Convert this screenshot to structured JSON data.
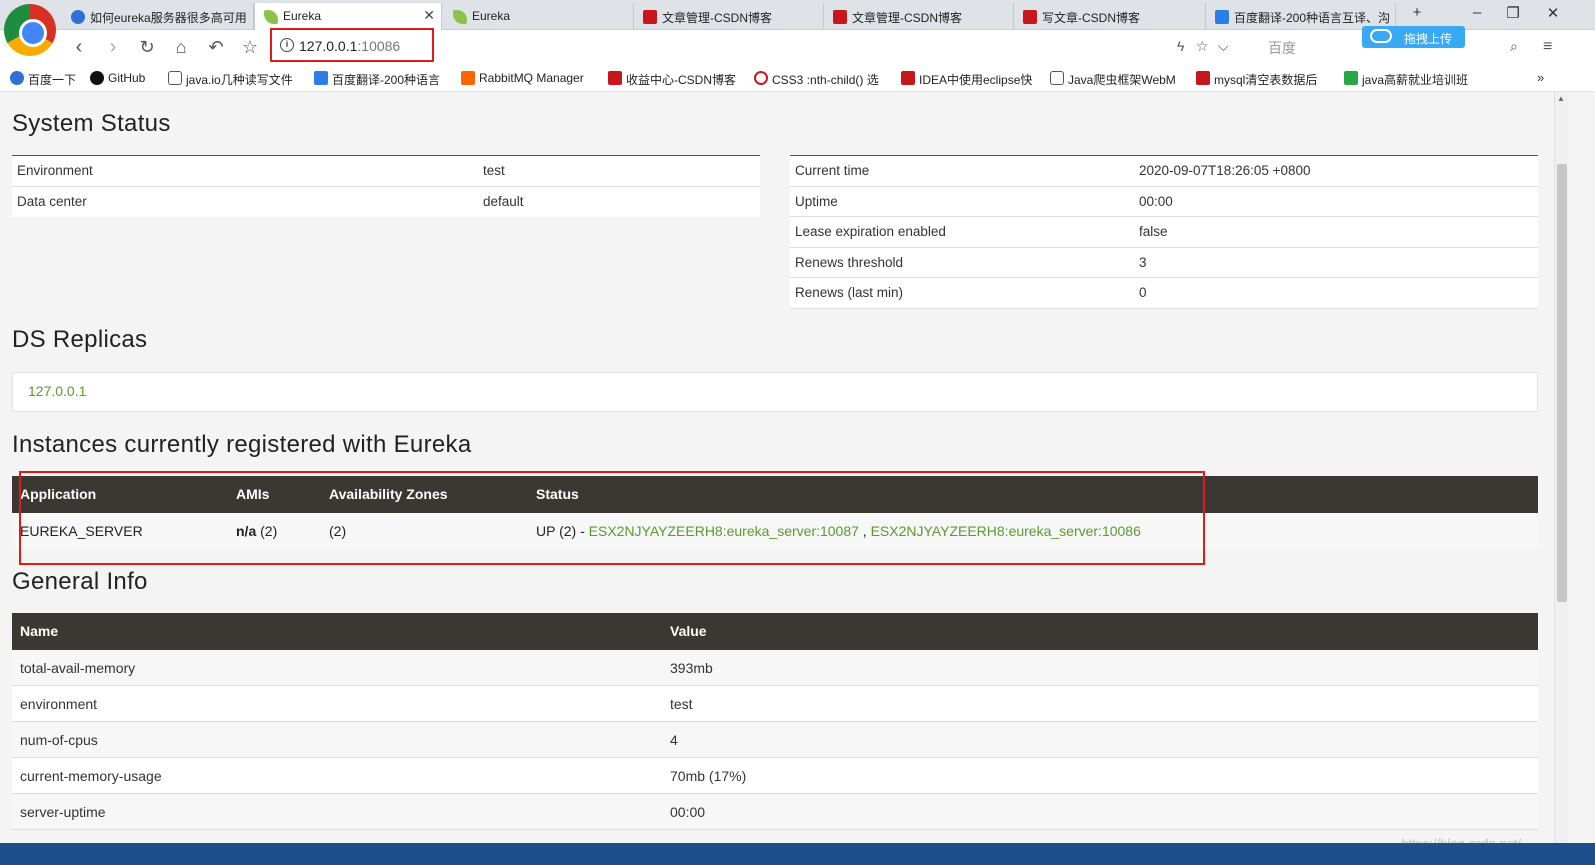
{
  "browser": {
    "tabs": [
      {
        "label": "如何eureka服务器很多高可用",
        "icon": "paw-icon"
      },
      {
        "label": "Eureka",
        "icon": "leaf-icon",
        "active": true
      },
      {
        "label": "Eureka",
        "icon": "leaf-icon"
      },
      {
        "label": "文章管理-CSDN博客",
        "icon": "csdn-icon"
      },
      {
        "label": "文章管理-CSDN博客",
        "icon": "csdn-icon"
      },
      {
        "label": "写文章-CSDN博客",
        "icon": "csdn-icon"
      },
      {
        "label": "百度翻译-200种语言互译、沟",
        "icon": "translate-icon"
      }
    ],
    "url_host": "127.0.0.1",
    "url_port": ":10086",
    "search_placeholder": "百度",
    "upload_label": "拖拽上传",
    "bookmarks": [
      "百度一下",
      "GitHub",
      "java.io几种读写文件",
      "百度翻译-200种语言",
      "RabbitMQ Manager",
      "收益中心-CSDN博客",
      "CSS3 :nth-child() 选",
      "IDEA中使用eclipse快",
      "Java爬虫框架WebM",
      "mysql清空表数据后",
      "java高薪就业培训班"
    ]
  },
  "system_status": {
    "title": "System Status",
    "left": [
      {
        "key": "Environment",
        "value": "test"
      },
      {
        "key": "Data center",
        "value": "default"
      }
    ],
    "right": [
      {
        "key": "Current time",
        "value": "2020-09-07T18:26:05 +0800"
      },
      {
        "key": "Uptime",
        "value": "00:00"
      },
      {
        "key": "Lease expiration enabled",
        "value": "false"
      },
      {
        "key": "Renews threshold",
        "value": "3"
      },
      {
        "key": "Renews (last min)",
        "value": "0"
      }
    ]
  },
  "replicas": {
    "title": "DS Replicas",
    "items": [
      "127.0.0.1"
    ]
  },
  "instances": {
    "title": "Instances currently registered with Eureka",
    "headers": [
      "Application",
      "AMIs",
      "Availability Zones",
      "Status"
    ],
    "rows": [
      {
        "application": "EUREKA_SERVER",
        "amis_bold": "n/a",
        "amis_count": " (2)",
        "zones": "(2)",
        "status_prefix": "UP (2) - ",
        "link1": "ESX2NJYAYZEERH8:eureka_server:10087",
        "sep": " , ",
        "link2": "ESX2NJYAYZEERH8:eureka_server:10086"
      }
    ]
  },
  "general_info": {
    "title": "General Info",
    "headers": [
      "Name",
      "Value"
    ],
    "rows": [
      {
        "name": "total-avail-memory",
        "value": "393mb"
      },
      {
        "name": "environment",
        "value": "test"
      },
      {
        "name": "num-of-cpus",
        "value": "4"
      },
      {
        "name": "current-memory-usage",
        "value": "70mb (17%)"
      },
      {
        "name": "server-uptime",
        "value": "00:00"
      }
    ]
  },
  "watermark": "https://blog.csdn.net/..."
}
